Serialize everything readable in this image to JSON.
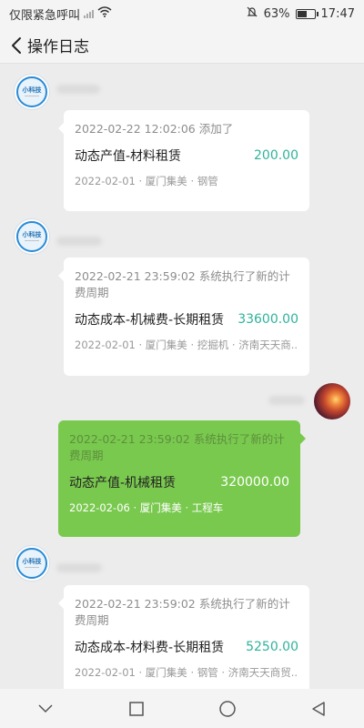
{
  "status_bar": {
    "carrier": "仅限紧急呼叫",
    "battery": "63%",
    "battery_level": 0.63,
    "time": "17:47"
  },
  "header": {
    "title": "操作日志"
  },
  "avatar_text": "小科技",
  "messages": [
    {
      "header": "2022-02-22 12:02:06 添加了",
      "title": "动态产值-材料租赁",
      "amount": "200.00",
      "meta": "2022-02-01 · 厦门集美 · 钢管"
    },
    {
      "header": "2022-02-21 23:59:02 系统执行了新的计费周期",
      "title": "动态成本-机械费-长期租赁",
      "amount": "33600.00",
      "meta": "2022-02-01 · 厦门集美 · 挖掘机 · 济南天天商..."
    },
    {
      "header": "2022-02-21 23:59:02 系统执行了新的计费周期",
      "title": "动态产值-机械租赁",
      "amount": "320000.00",
      "meta": "2022-02-06 · 厦门集美 · 工程车"
    },
    {
      "header": "2022-02-21 23:59:02 系统执行了新的计费周期",
      "title": "动态成本-材料费-长期租赁",
      "amount": "5250.00",
      "meta": "2022-02-01 · 厦门集美 · 钢管 · 济南天天商贸..."
    }
  ],
  "colors": {
    "amount": "#2fb39b",
    "own_bubble": "#7ac94f",
    "logo": "#2a8ad4"
  },
  "icons": {
    "back": "chevron-left-icon",
    "nav_back": "triangle-back-icon",
    "nav_home": "circle-home-icon",
    "nav_recent": "square-recent-icon",
    "nav_down": "chevron-down-icon"
  }
}
